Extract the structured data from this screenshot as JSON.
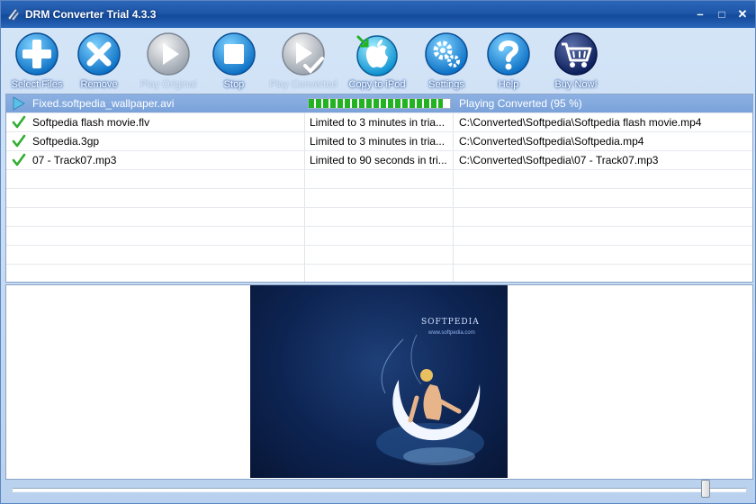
{
  "window": {
    "title": "DRM Converter Trial 4.3.3",
    "controls": {
      "minimize": "–",
      "maximize": "□",
      "close": "✕"
    }
  },
  "toolbar": {
    "items": [
      {
        "label": "Select Files",
        "icon": "plus-icon",
        "enabled": true
      },
      {
        "label": "Remove",
        "icon": "x-icon",
        "enabled": true
      },
      {
        "label": "Play Original",
        "icon": "play-icon",
        "enabled": false
      },
      {
        "label": "Stop",
        "icon": "stop-icon",
        "enabled": true
      },
      {
        "label": "Play Converted",
        "icon": "play-check-icon",
        "enabled": false
      },
      {
        "label": "Copy to iPod",
        "icon": "apple-icon",
        "enabled": true
      },
      {
        "label": "Settings",
        "icon": "gears-icon",
        "enabled": true
      },
      {
        "label": "Help",
        "icon": "question-icon",
        "enabled": true
      },
      {
        "label": "Buy Now!",
        "icon": "cart-icon",
        "enabled": true
      }
    ]
  },
  "files": {
    "rows": [
      {
        "name": "Fixed.softpedia_wallpaper.avi",
        "limit": "",
        "status": "Playing Converted (95 %)",
        "progress_percent": 95,
        "icon": "play-arrow-icon",
        "selected": true
      },
      {
        "name": "Softpedia flash movie.flv",
        "limit": "Limited to 3 minutes in tria...",
        "status": "C:\\Converted\\Softpedia\\Softpedia flash movie.mp4",
        "icon": "checkmark-icon",
        "selected": false
      },
      {
        "name": "Softpedia.3gp",
        "limit": "Limited to 3 minutes in tria...",
        "status": "C:\\Converted\\Softpedia\\Softpedia.mp4",
        "icon": "checkmark-icon",
        "selected": false
      },
      {
        "name": "07 - Track07.mp3",
        "limit": "Limited to 90 seconds in tri...",
        "status": "C:\\Converted\\Softpedia\\07 - Track07.mp3",
        "icon": "checkmark-icon",
        "selected": false
      }
    ]
  },
  "preview": {
    "logo_text": "SOFTPEDIA",
    "logo_sub": "www.softpedia.com"
  },
  "playback": {
    "position_fraction": 0.95
  },
  "colors": {
    "titlebar": "#1e56a8",
    "selected_row": "#7aa2da",
    "progress": "#22b222",
    "check": "#2fae2f"
  }
}
